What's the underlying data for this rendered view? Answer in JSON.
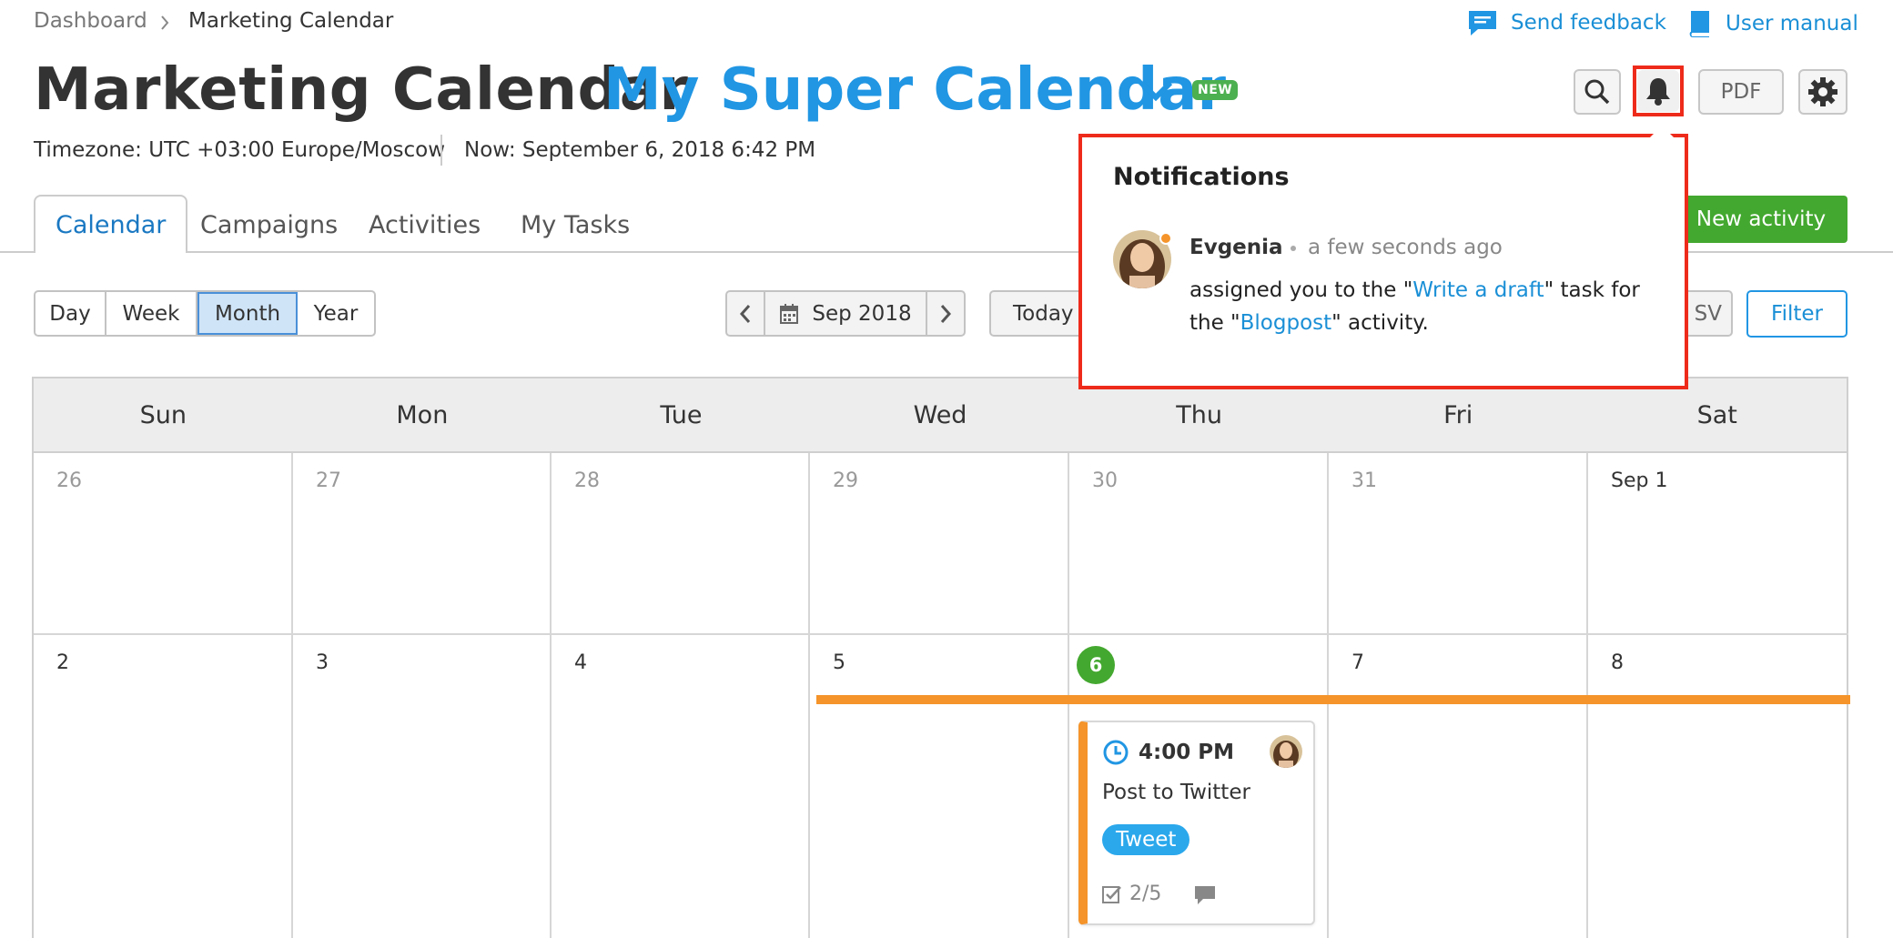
{
  "breadcrumb": {
    "home": "Dashboard",
    "current": "Marketing Calendar"
  },
  "toplinks": {
    "feedback": "Send feedback",
    "manual": "User manual"
  },
  "header": {
    "title": "Marketing Calendar",
    "calendar_name": "My Super Calendar",
    "badge": "NEW",
    "timezone": "Timezone: UTC +03:00 Europe/Moscow",
    "now": "Now: September 6, 2018 6:42 PM"
  },
  "toolbar": {
    "pdf": "PDF"
  },
  "tabs": [
    {
      "label": "Calendar",
      "active": true
    },
    {
      "label": "Campaigns"
    },
    {
      "label": "Activities"
    },
    {
      "label": "My Tasks"
    }
  ],
  "new_activity": "New activity",
  "view_switch": [
    "Day",
    "Week",
    "Month",
    "Year"
  ],
  "view_selected": "Month",
  "period_label": "Sep 2018",
  "today_label": "Today",
  "export_partial": "SV",
  "filter_label": "Filter",
  "weekdays": [
    "Sun",
    "Mon",
    "Tue",
    "Wed",
    "Thu",
    "Fri",
    "Sat"
  ],
  "week1": [
    "26",
    "27",
    "28",
    "29",
    "30",
    "31",
    "Sep 1"
  ],
  "week2": [
    "2",
    "3",
    "4",
    "5",
    "6",
    "7",
    "8"
  ],
  "event": {
    "time": "4:00 PM",
    "title": "Post to Twitter",
    "tag": "Tweet",
    "tasks": "2/5"
  },
  "notifications": {
    "title": "Notifications",
    "user": "Evgenia",
    "time": "a few seconds ago",
    "text_1": "assigned you to the \"",
    "link_1": "Write a draft",
    "text_2": "\" task for the \"",
    "link_2": "Blogpost",
    "text_3": "\" activity."
  },
  "colors": {
    "accent": "#2196e3",
    "green": "#43a82f",
    "orange": "#f5942a",
    "highlight": "#ee2b1b"
  }
}
